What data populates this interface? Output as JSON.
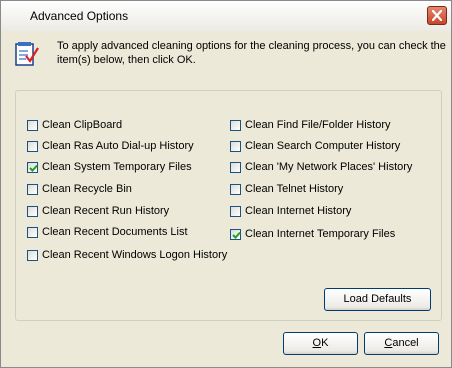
{
  "window": {
    "title": "Advanced Options"
  },
  "intro_text": "To apply advanced cleaning options for the cleaning process, you can check the item(s) below, then click OK.",
  "options": {
    "left": [
      {
        "label": "Clean ClipBoard",
        "checked": false
      },
      {
        "label": "Clean Ras Auto Dial-up History",
        "checked": false
      },
      {
        "label": "Clean System Temporary Files",
        "checked": true
      },
      {
        "label": "Clean Recycle Bin",
        "checked": false
      },
      {
        "label": "Clean Recent Run History",
        "checked": false
      },
      {
        "label": "Clean Recent Documents List",
        "checked": false
      },
      {
        "label": "Clean Recent Windows Logon History",
        "checked": false
      }
    ],
    "right": [
      {
        "label": "Clean Find File/Folder History",
        "checked": false
      },
      {
        "label": "Clean Search Computer History",
        "checked": false
      },
      {
        "label": "Clean 'My Network Places' History",
        "checked": false
      },
      {
        "label": "Clean Telnet History",
        "checked": false
      },
      {
        "label": "Clean Internet History",
        "checked": false
      },
      {
        "label": "Clean Internet Temporary Files",
        "checked": true
      }
    ]
  },
  "buttons": {
    "load_defaults": "Load Defaults",
    "ok_first": "O",
    "ok_rest": "K",
    "cancel_first": "C",
    "cancel_rest": "ancel"
  },
  "icons": {
    "close": "close-icon",
    "info": "checklist-icon"
  },
  "colors": {
    "checkmark": "#21a121",
    "close_button": "#c7452a",
    "dialog_face": "#ece9d8",
    "button_border": "#003c74"
  }
}
